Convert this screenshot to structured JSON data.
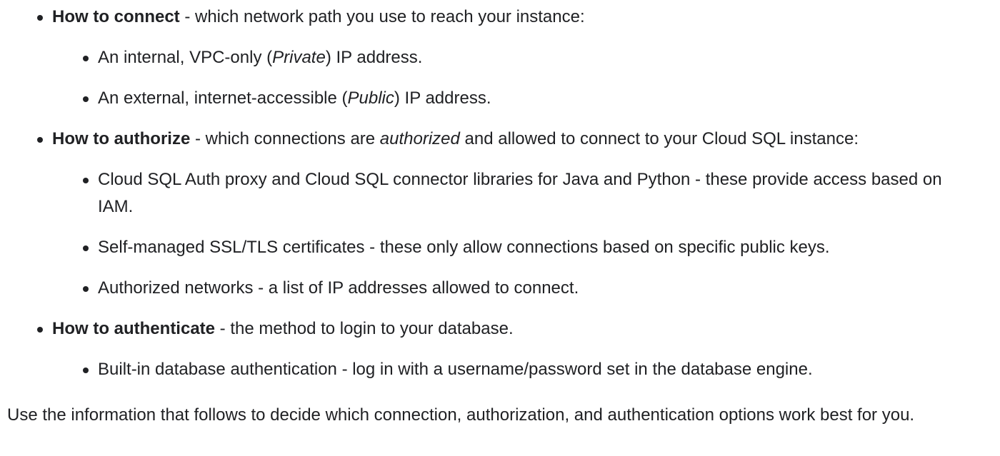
{
  "sections": [
    {
      "heading": "How to connect",
      "desc": " - which network path you use to reach your instance:",
      "items": [
        {
          "pre": "An internal, VPC-only (",
          "em": "Private",
          "post": ") IP address."
        },
        {
          "pre": "An external, internet-accessible (",
          "em": "Public",
          "post": ") IP address."
        }
      ]
    },
    {
      "heading": "How to authorize",
      "desc_pre": " - which connections are ",
      "desc_em": "authorized",
      "desc_post": " and allowed to connect to your Cloud SQL instance:",
      "items": [
        {
          "text": "Cloud SQL Auth proxy and Cloud SQL connector libraries for Java and Python - these provide access based on IAM."
        },
        {
          "text": "Self-managed SSL/TLS certificates - these only allow connections based on specific public keys."
        },
        {
          "text": "Authorized networks - a list of IP addresses allowed to connect."
        }
      ]
    },
    {
      "heading": "How to authenticate",
      "desc": " - the method to login to your database.",
      "items": [
        {
          "text": "Built-in database authentication - log in with a username/password set in the database engine."
        }
      ]
    }
  ],
  "footer": "Use the information that follows to decide which connection, authorization, and authentication options work best for you."
}
